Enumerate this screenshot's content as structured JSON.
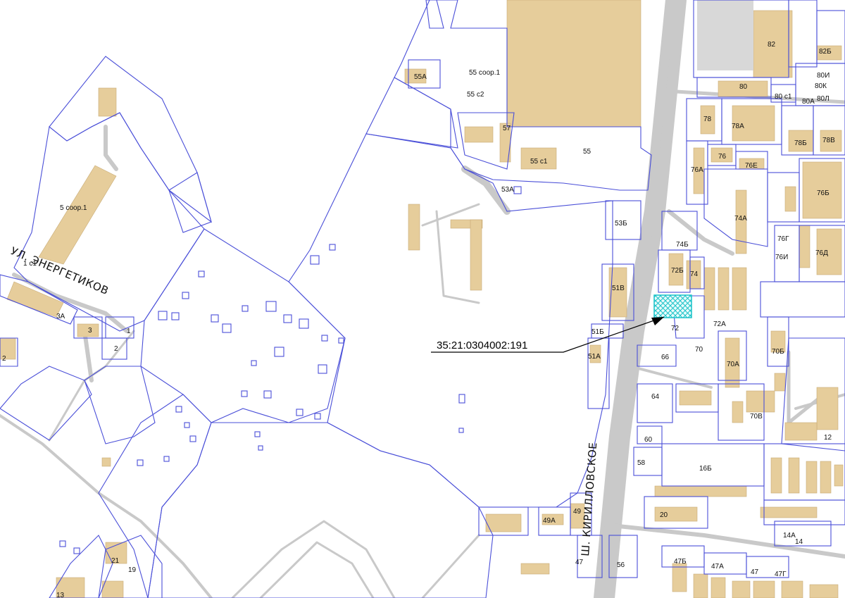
{
  "map": {
    "background": "#ffffff",
    "colors": {
      "parcel_boundary": "#4a4fd8",
      "building": "#e6cd9b",
      "road": "#c9c9c9",
      "highlight": "#19c2c8",
      "callout_line": "#000000"
    },
    "streets": {
      "energetikov": "УЛ. ЭНЕРГЕТИКОВ",
      "kirillovskoe": "Ш. КИРИЛЛОВСКОЕ"
    },
    "highlight_parcel": {
      "cadastral_number": "35:21:0304002:191",
      "pattern": "cross-hatch"
    },
    "labels": {
      "l82": "82",
      "l82b": "82Б",
      "l80i": "80И",
      "l80k": "80К",
      "l80l": "80Л",
      "l80": "80",
      "l80c1": "80 с1",
      "l80a": "80А",
      "l55a": "55А",
      "l55soor1": "55 соор.1",
      "l55c2": "55 с2",
      "l57": "57",
      "l55c1": "55 с1",
      "l55": "55",
      "l53a": "53А",
      "l78": "78",
      "l78a": "78А",
      "l78b": "78Б",
      "l78v": "78В",
      "l76": "76",
      "l76a": "76А",
      "l76e": "76Е",
      "l76b": "76Б",
      "l74a": "74А",
      "l53b": "53Б",
      "l74b": "74Б",
      "l76g": "76Г",
      "l76i": "76И",
      "l76d": "76Д",
      "l72b": "72Б",
      "l74": "74",
      "l51v": "51В",
      "l72": "72",
      "l72a": "72А",
      "l51b": "51Б",
      "l70": "70",
      "l70b": "70Б",
      "l51a": "51А",
      "l66": "66",
      "l70a": "70А",
      "l64": "64",
      "l70v": "70В",
      "l60": "60",
      "l12": "12",
      "l58": "58",
      "l16b": "16Б",
      "l49": "49",
      "l49a": "49А",
      "l20": "20",
      "l14a": "14А",
      "l14": "14",
      "l47": "47",
      "l56": "56",
      "l47b": "47Б",
      "l47a": "47А",
      "l47_2": "47",
      "l47g": "47Г",
      "l5soor1": "5 соор.1",
      "l1c1": "1 с1",
      "l3a": "3А",
      "l3": "3",
      "l1": "1",
      "l2": "2",
      "l2w": "2",
      "l21": "21",
      "l19": "19",
      "l13": "13"
    }
  }
}
